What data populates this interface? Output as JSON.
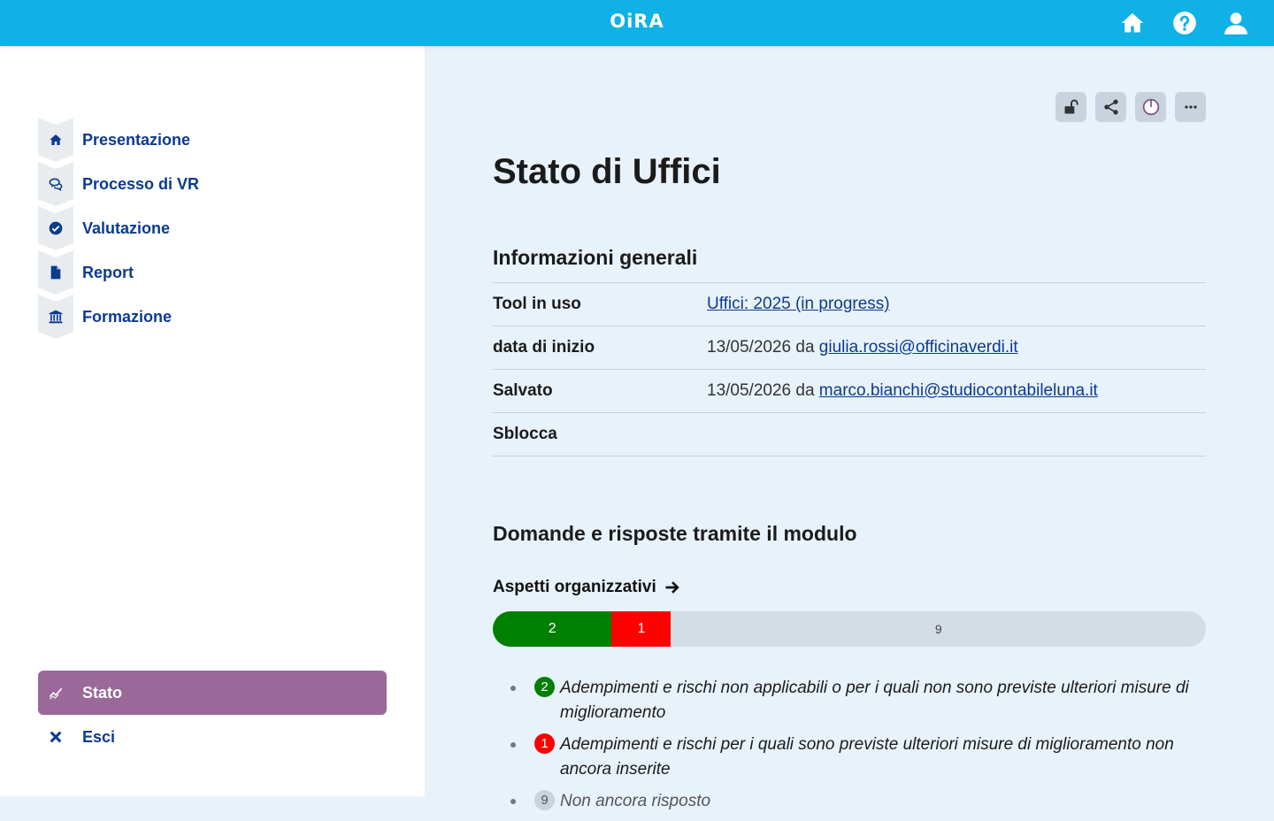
{
  "header": {
    "logo": "OiRA",
    "icons": [
      "home-icon",
      "help-icon",
      "user-icon"
    ],
    "bg_color": "#0fb1e6"
  },
  "sidebar": {
    "items": [
      {
        "label": "Presentazione",
        "icon": "home-icon"
      },
      {
        "label": "Processo di VR",
        "icon": "chat-icon"
      },
      {
        "label": "Valutazione",
        "icon": "check-circle-icon"
      },
      {
        "label": "Report",
        "icon": "document-icon"
      },
      {
        "label": "Formazione",
        "icon": "institution-icon"
      }
    ],
    "bottom_items": [
      {
        "label": "Stato",
        "icon": "chart-icon",
        "active": true
      },
      {
        "label": "Esci",
        "icon": "close-icon"
      }
    ],
    "active_color": "#9a6899"
  },
  "toolbar": {
    "icons": [
      "unlock-icon",
      "share-icon",
      "status-icon",
      "more-icon"
    ]
  },
  "main": {
    "title": "Stato di Uffici",
    "general_title": "Informazioni generali",
    "info": [
      {
        "key": "Tool in uso",
        "link": "Uffici: 2025 (in progress)"
      },
      {
        "key": "data di inizio",
        "value": "13/05/2026 da ",
        "link": "giulia.rossi@officinaverdi.it"
      },
      {
        "key": "Salvato",
        "value": "13/05/2026 da ",
        "link": "marco.bianchi@studiocontabileluna.it"
      },
      {
        "key": "Sblocca",
        "value": ""
      }
    ],
    "qa_title": "Domande e risposte tramite il modulo",
    "category": {
      "title": "Aspetti organizzativi",
      "counts": {
        "ok": 2,
        "risk": 1,
        "todo": 9
      },
      "colors": {
        "ok": "#008000",
        "risk": "#ff0000",
        "todo": "#d4dde5"
      }
    },
    "legend": [
      {
        "count": "2",
        "text": "Adempimenti e rischi non applicabili o per i quali non sono previste ulteriori misure di miglioramento"
      },
      {
        "count": "1",
        "text": "Adempimenti e rischi per i quali sono previste ulteriori misure di miglioramento non ancora inserite"
      },
      {
        "count": "9",
        "text": "Non ancora risposto"
      }
    ]
  }
}
